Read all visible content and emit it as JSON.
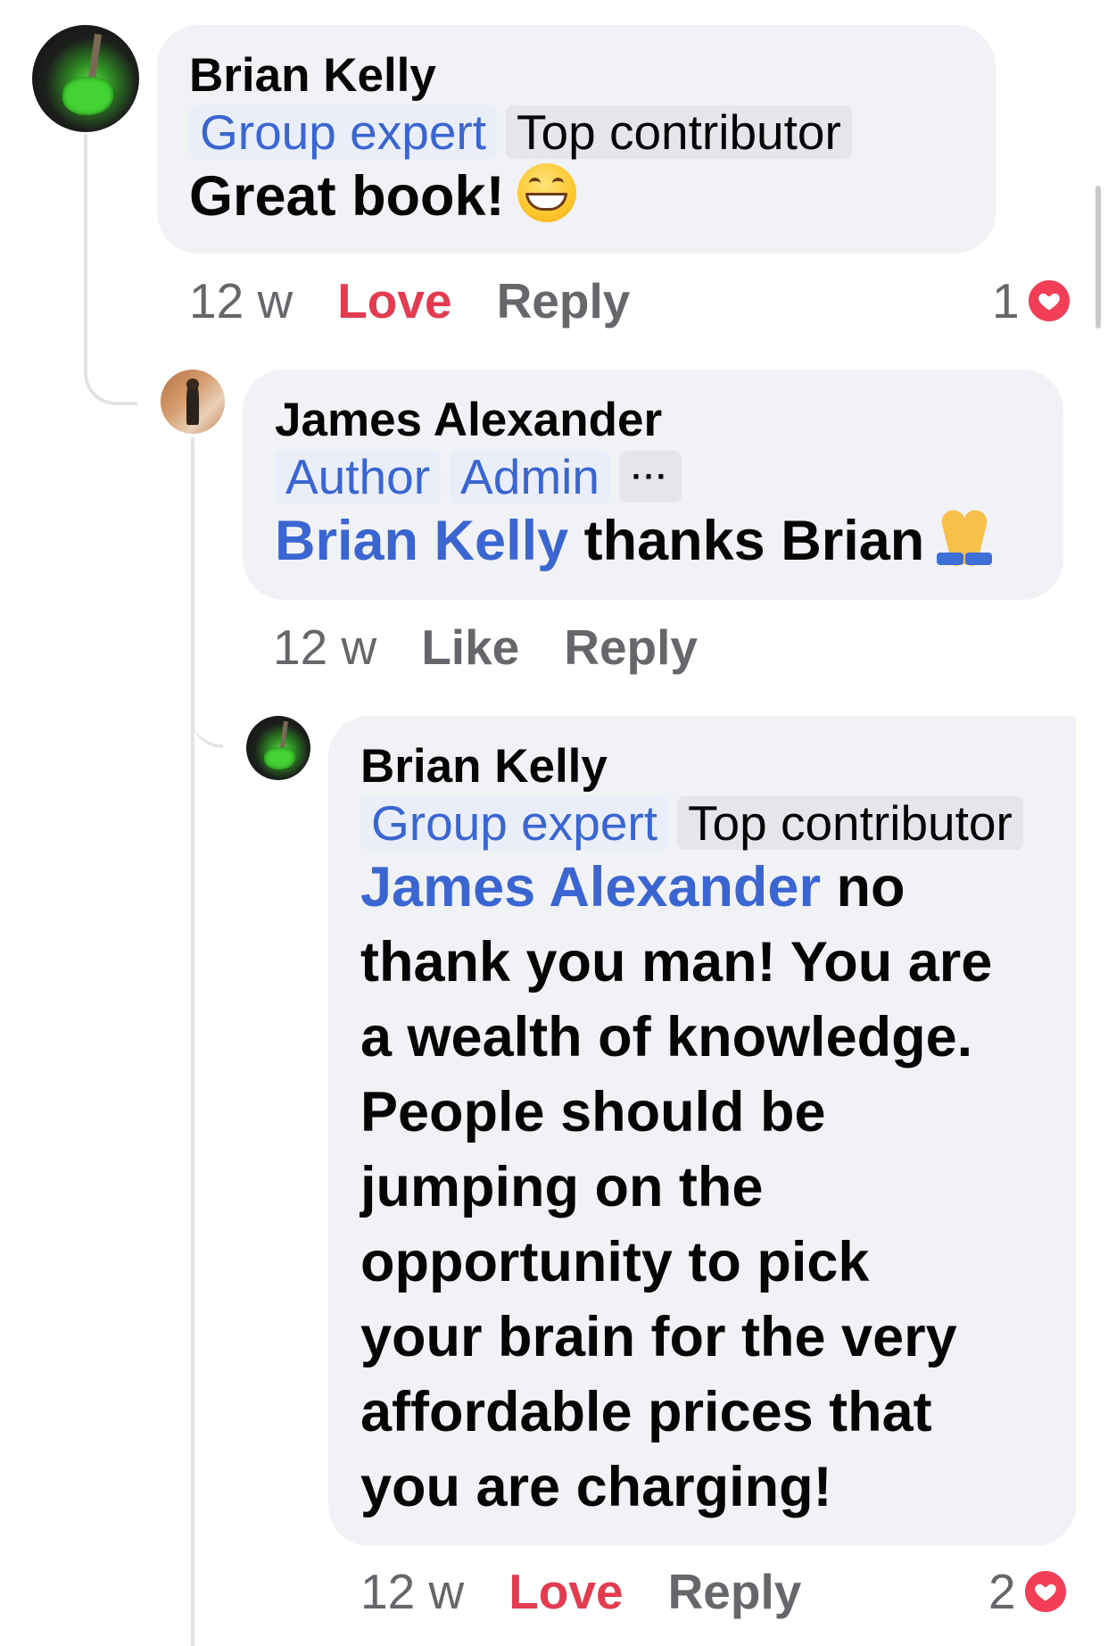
{
  "comments": [
    {
      "author": "Brian Kelly",
      "badges": [
        "Group expert",
        "Top contributor"
      ],
      "text": "Great book!",
      "emoji": "grinning-face-icon",
      "time": "12 w",
      "reaction_label": "Love",
      "reply_label": "Reply",
      "reaction_count": "1",
      "reaction_icon": "heart-icon"
    },
    {
      "author": "James Alexander",
      "badges": [
        "Author",
        "Admin"
      ],
      "more_label": "···",
      "mention": "Brian Kelly",
      "text": "thanks Brian",
      "emoji": "folded-hands-icon",
      "time": "12 w",
      "reaction_label": "Like",
      "reply_label": "Reply"
    },
    {
      "author": "Brian Kelly",
      "badges": [
        "Group expert",
        "Top contributor"
      ],
      "mention": "James Alexander",
      "text_lines": [
        "no",
        "thank you man! You are",
        "a wealth of knowledge.",
        "People should be",
        "jumping on the",
        "opportunity to pick",
        "your brain for the very",
        "affordable prices that",
        "you are charging!"
      ],
      "time": "12 w",
      "reaction_label": "Love",
      "reply_label": "Reply",
      "reaction_count": "2",
      "reaction_icon": "heart-icon"
    }
  ],
  "colors": {
    "bubble": "#f0f2f5",
    "mention_blue": "#3b65d1",
    "love_red": "#e33b50",
    "meta_gray": "#65676b"
  }
}
